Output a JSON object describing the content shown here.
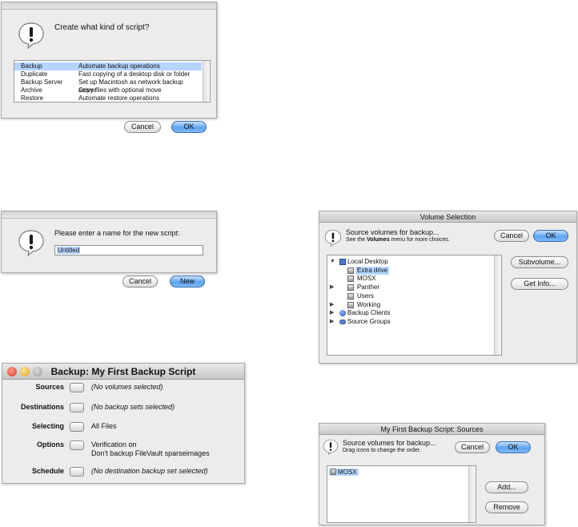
{
  "create_dialog": {
    "prompt": "Create what kind of script?",
    "options": [
      {
        "name": "Backup",
        "description": "Automate backup operations",
        "selected": true
      },
      {
        "name": "Duplicate",
        "description": "Fast copying of a desktop disk or folder",
        "selected": false
      },
      {
        "name": "Backup Server",
        "description": "Set up Macintosh as network backup server",
        "selected": false
      },
      {
        "name": "Archive",
        "description": "Copy files with optional move",
        "selected": false
      },
      {
        "name": "Restore",
        "description": "Automate restore operations",
        "selected": false
      }
    ],
    "cancel_label": "Cancel",
    "ok_label": "OK"
  },
  "name_dialog": {
    "prompt": "Please enter a name for the new script:",
    "name_value": "Untitled",
    "cancel_label": "Cancel",
    "new_label": "New"
  },
  "summary_window": {
    "title": "Backup: My First Backup Script",
    "rows": [
      {
        "label": "Sources",
        "value": "(No volumes selected)",
        "italic": true
      },
      {
        "label": "Destinations",
        "value": "(No backup sets selected)",
        "italic": true
      },
      {
        "label": "Selecting",
        "value": "All Files",
        "italic": false
      },
      {
        "label": "Options",
        "value": "Verification on",
        "value2": "Don't backup FileVault sparseimages",
        "italic": false
      },
      {
        "label": "Schedule",
        "value": "(No destination backup set selected)",
        "italic": true
      }
    ]
  },
  "volume_selection": {
    "title": "Volume Selection",
    "heading": "Source volumes for backup...",
    "hint_prefix": "See the ",
    "hint_bold": "Volumes",
    "hint_suffix": " menu for more choices.",
    "cancel_label": "Cancel",
    "ok_label": "OK",
    "subvolume_label": "Subvolume...",
    "get_info_label": "Get Info...",
    "tree": [
      {
        "label": "Local Desktop",
        "level": 0,
        "expanded": true,
        "icon": "computer-icon"
      },
      {
        "label": "Extra drive",
        "level": 1,
        "selected": true,
        "icon": "disk-icon"
      },
      {
        "label": "MOSX",
        "level": 1,
        "icon": "disk-icon"
      },
      {
        "label": "Panther",
        "level": 1,
        "collapsed": true,
        "icon": "disk-icon"
      },
      {
        "label": "Users",
        "level": 1,
        "icon": "disk-icon"
      },
      {
        "label": "Working",
        "level": 1,
        "collapsed": true,
        "icon": "disk-icon"
      },
      {
        "label": "Backup Clients",
        "level": 0,
        "collapsed": true,
        "icon": "network-icon"
      },
      {
        "label": "Source Groups",
        "level": 0,
        "collapsed": true,
        "icon": "group-icon"
      }
    ]
  },
  "sources_window": {
    "title": "My First Backup Script: Sources",
    "heading": "Source volumes for backup...",
    "hint": "Drag icons to change the order.",
    "cancel_label": "Cancel",
    "ok_label": "OK",
    "volumes": [
      "MOSX"
    ],
    "add_label": "Add...",
    "remove_label": "Remove"
  }
}
